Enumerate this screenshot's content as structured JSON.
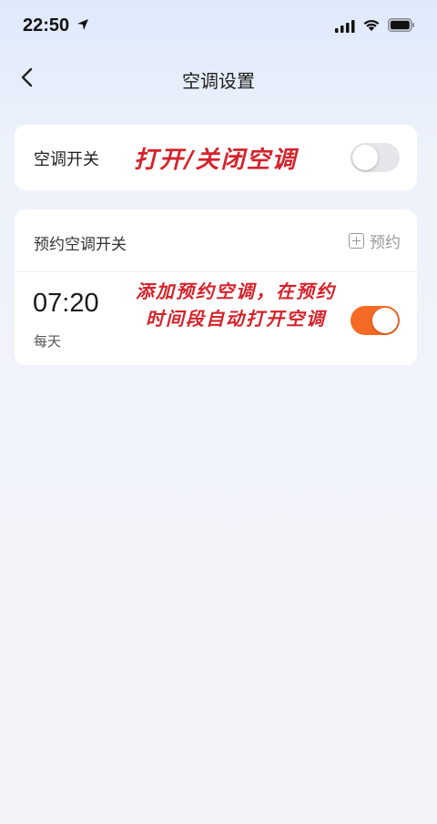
{
  "status_bar": {
    "time": "22:50",
    "icons": [
      "location-arrow-icon",
      "cellular-signal-icon",
      "wifi-icon",
      "battery-icon"
    ]
  },
  "nav": {
    "back_icon": "chevron-left-icon",
    "title": "空调设置"
  },
  "ac_switch": {
    "label": "空调开关",
    "annotation": "打开/关闭空调",
    "enabled": false
  },
  "schedule": {
    "header_label": "预约空调开关",
    "add_label": "预约",
    "add_icon": "plus-square-icon",
    "items": [
      {
        "time": "07:20",
        "repeat": "每天",
        "enabled": true
      }
    ],
    "annotation_line1": "添加预约空调，在预约",
    "annotation_line2": "时间段自动打开空调"
  },
  "colors": {
    "accent_toggle_on": "#f56a25",
    "toggle_off": "#e5e5ea",
    "annotation": "#d4232b"
  }
}
